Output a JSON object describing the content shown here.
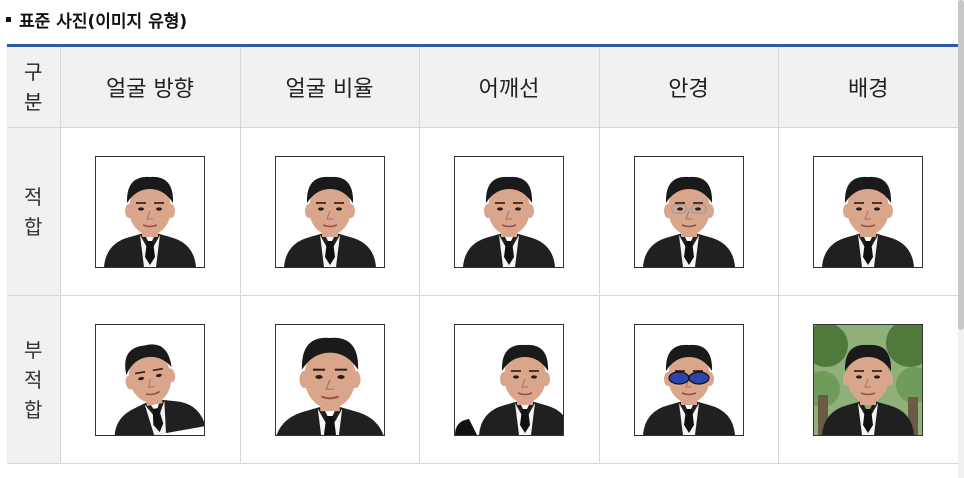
{
  "section_title": "표준 사진(이미지 유형)",
  "table": {
    "corner": [
      "구",
      "분"
    ],
    "columns": [
      "얼굴 방향",
      "얼굴 비율",
      "어깨선",
      "안경",
      "배경"
    ],
    "rows": [
      {
        "label": [
          "적",
          "합"
        ],
        "photos": [
          {
            "icon": "passport-photo-icon",
            "variant": "standard"
          },
          {
            "icon": "passport-photo-icon",
            "variant": "standard"
          },
          {
            "icon": "passport-photo-icon",
            "variant": "standard"
          },
          {
            "icon": "passport-photo-icon",
            "variant": "clear-glasses"
          },
          {
            "icon": "passport-photo-icon",
            "variant": "standard"
          }
        ]
      },
      {
        "label": [
          "부",
          "적",
          "합"
        ],
        "photos": [
          {
            "icon": "passport-photo-icon",
            "variant": "tilted-face"
          },
          {
            "icon": "passport-photo-icon",
            "variant": "face-too-large"
          },
          {
            "icon": "passport-photo-icon",
            "variant": "shoulders-off-center"
          },
          {
            "icon": "passport-photo-icon",
            "variant": "tinted-sunglasses"
          },
          {
            "icon": "passport-photo-icon",
            "variant": "tree-background"
          }
        ]
      }
    ]
  },
  "colors": {
    "header_rule": "#2c5aa8",
    "header_bg": "#f1f1f1",
    "grid_line": "#d7d7d7",
    "suit": "#202020",
    "skin": "#d9a68c",
    "hair": "#1a1a1a",
    "sunglass_lens": "#2b45a8",
    "tree_green": "#4f7a3c"
  }
}
